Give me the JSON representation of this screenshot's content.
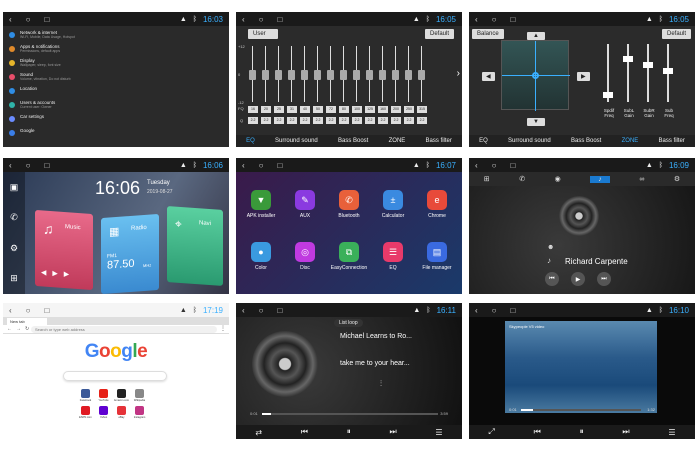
{
  "times": {
    "t1": "16:03",
    "t2": "16:05",
    "t3": "16:05",
    "t4": "16:06",
    "t5": "16:07",
    "t6": "16:09",
    "t7": "17:19",
    "t8": "16:11",
    "t9": "16:10"
  },
  "settings": [
    {
      "title": "Network & internet",
      "sub": "Wi-Fi, Mobile, Data Usage, Hotspot",
      "color": "#2f8de4"
    },
    {
      "title": "Apps & notifications",
      "sub": "Permissions, default apps",
      "color": "#e08a2a"
    },
    {
      "title": "Display",
      "sub": "Wallpaper, sleep, font size",
      "color": "#e6b52a"
    },
    {
      "title": "Sound",
      "sub": "Volume, vibration, Do not disturb",
      "color": "#e84e6a"
    },
    {
      "title": "Location",
      "sub": "",
      "color": "#2f8de4"
    },
    {
      "title": "Users & accounts",
      "sub": "Current user: Owner",
      "color": "#2fb3a8"
    },
    {
      "title": "Car settings",
      "sub": "",
      "color": "#6a8cff"
    },
    {
      "title": "Google",
      "sub": "",
      "color": "#3a7ee8"
    }
  ],
  "eq": {
    "preset": "User",
    "default_label": "Default",
    "scale": [
      "+12",
      "0",
      "-12"
    ],
    "freq_prefix": "FQ",
    "q_prefix": "Q",
    "freqs": [
      "16",
      "20",
      "25",
      "31",
      "40",
      "50",
      "72",
      "80",
      "100",
      "125",
      "160",
      "200",
      "250",
      "315"
    ],
    "qs": [
      "2.2",
      "2.2",
      "2.2",
      "2.2",
      "2.2",
      "2.2",
      "2.2",
      "2.2",
      "2.2",
      "2.2",
      "2.2",
      "2.2",
      "2.2",
      "2.2"
    ],
    "tabs": [
      "EQ",
      "Surround sound",
      "Bass Boost",
      "ZONE",
      "Bass filter"
    ]
  },
  "balance": {
    "title": "Balance",
    "default_label": "Default",
    "labels": [
      "Spdif Freq",
      "SubL Gain",
      "SubR Gain",
      "Sub Freq"
    ],
    "tabs": [
      "EQ",
      "Surround sound",
      "Bass Boost",
      "ZONE",
      "Bass filter"
    ]
  },
  "home": {
    "time": "16:06",
    "day": "Tuesday",
    "date": "2019-08-27",
    "music": "Music",
    "radio": "Radio",
    "navi": "Navi",
    "fm": "FM1",
    "freq": "87.50",
    "mhz": "MHz"
  },
  "apps": [
    {
      "label": "APK installer",
      "color": "#3a9a3a",
      "icon": "▼"
    },
    {
      "label": "AUX",
      "color": "#8a3ae0",
      "icon": "✎"
    },
    {
      "label": "Bluetooth",
      "color": "#e8603a",
      "icon": "✆"
    },
    {
      "label": "Calculator",
      "color": "#3a8ae0",
      "icon": "±"
    },
    {
      "label": "Chrome",
      "color": "#e84a3a",
      "icon": "e"
    },
    {
      "label": "Color",
      "color": "#3a9ae0",
      "icon": "●"
    },
    {
      "label": "Disc",
      "color": "#c03ae0",
      "icon": "◎"
    },
    {
      "label": "EasyConnection",
      "color": "#3ab05a",
      "icon": "⧉"
    },
    {
      "label": "EQ",
      "color": "#e83a6a",
      "icon": "☰"
    },
    {
      "label": "File manager",
      "color": "#3a6ae0",
      "icon": "▤"
    }
  ],
  "bt": {
    "artist": "Richard Carpente"
  },
  "browser": {
    "tab": "New tab",
    "url": "Search or type web address",
    "logo": "Google",
    "search": "",
    "shortcuts": [
      "Facebook",
      "YouTube",
      "Amazon.com",
      "Wikipedia",
      "ESPN.com",
      "Yahoo",
      "eBay",
      "Instagram"
    ]
  },
  "music": {
    "mode": "List loop",
    "title": "Michael Learns to Ro...",
    "lyric": "take me to your hear...",
    "elapsed": "0:01",
    "total": "3:59",
    "progress": 0.05
  },
  "video": {
    "title": "Skypeople V5 video",
    "elapsed": "0:01",
    "total": "1:32",
    "progress": 0.1
  }
}
